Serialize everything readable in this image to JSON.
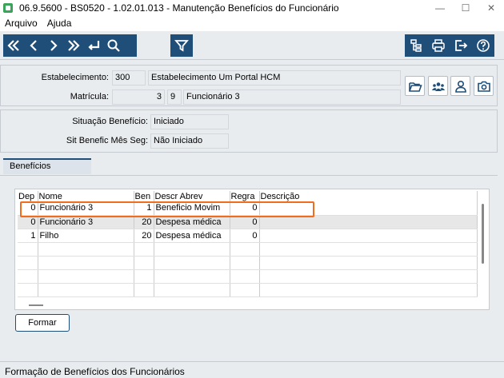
{
  "window": {
    "title": "06.9.5600 - BS0520 - 1.02.01.013 - Manutenção Benefícios do Funcionário",
    "minimize": "—",
    "maximize": "☐",
    "close": "✕"
  },
  "menu": {
    "file": "Arquivo",
    "help": "Ajuda"
  },
  "header": {
    "estab_label": "Estabelecimento:",
    "estab_code": "300",
    "estab_name": "Estabelecimento Um Portal HCM",
    "matricula_label": "Matrícula:",
    "matricula_value": "3",
    "matricula_digit": "9",
    "employee_name": "Funcionário 3"
  },
  "status_panel": {
    "sit_label": "Situação Benefício:",
    "sit_value": "Iniciado",
    "sit_mes_label": "Sit Benefic Mês Seg:",
    "sit_mes_value": "Não Iniciado"
  },
  "tab": {
    "label": "Benefícios"
  },
  "grid": {
    "headers": [
      "Dep",
      "Nome",
      "Ben",
      "Descr Abrev",
      "Regra",
      "Descrição"
    ],
    "rows": [
      [
        "0",
        "Funcionário 3",
        "1",
        "Beneficio Movim",
        "0",
        ""
      ],
      [
        "0",
        "Funcionário 3",
        "20",
        "Despesa médica",
        "0",
        ""
      ],
      [
        "1",
        "Filho",
        "20",
        "Despesa médica",
        "0",
        ""
      ]
    ]
  },
  "buttons": {
    "formar": "Formar"
  },
  "statusbar": {
    "text": "Formação de Benefícios dos Funcionários"
  },
  "colors": {
    "toolbar": "#1f4e79",
    "highlight": "#f06c1e"
  }
}
